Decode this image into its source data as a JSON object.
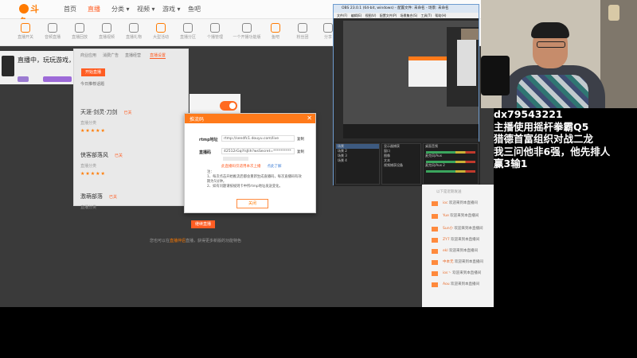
{
  "browser": {
    "logo": "斗鱼",
    "nav": [
      "首页",
      "直播",
      "分类 ▾",
      "视频 ▾",
      "游戏 ▾",
      "鱼吧"
    ],
    "nav_active": 1,
    "icon_row": [
      "直播开关",
      "音频直播",
      "直播回放",
      "直播视频",
      "直播礼物",
      "大型活动",
      "直播分区",
      "个播管理",
      "一个开播功能版",
      "鱼吧",
      "粉丝团",
      "分享"
    ]
  },
  "streamer": {
    "title": "直播中，玩玩游戏，对"
  },
  "panel": {
    "tabs": [
      "商业应用",
      "消费广告",
      "直播经营",
      "直播设置"
    ],
    "active_tab": 3,
    "start_button": "开始直播",
    "today_label": "今日推荐话题",
    "rows": [
      {
        "title": "天涯·剑灵·刀剑",
        "badge": "已关",
        "sub": "直播分类",
        "stars": "★★★★★"
      },
      {
        "title": "侠客部落风",
        "badge": "已关",
        "sub": "直播分类",
        "stars": "★★★★★"
      },
      {
        "title": "激萌部落",
        "badge": "已关",
        "sub": "直播分类",
        "stars": "★★★★★"
      }
    ]
  },
  "bottom": {
    "button": "继续直播",
    "note_before": "您也可以在",
    "note_highlight": "直播伴侣",
    "note_after": "直播，获得更多新版的功能特色"
  },
  "modal": {
    "title": "推流码",
    "close": "✕",
    "rtmp_label": "rtmp地址",
    "rtmp_value": "rtmp://sendfc1.douyu.com/live",
    "rtmp_copy": "复制",
    "key_label": "直播码",
    "key_value": "42512rGqiYsJlih?wsSecret=**********",
    "key_copy": "复制",
    "warn": "此直播码仅适用本次上播",
    "warn_link": "点此了解",
    "notes": [
      "注：",
      "1、每次点击开始推流后都会重新生成直播码，每次直播码有效期为5分钟。",
      "2、如有问题请按规则卡中所rtmp地址发送变化。"
    ],
    "ok": "关闭"
  },
  "obs": {
    "title": "OBS 23.0.1 (64-bit, windows) - 配置文件: 未命名 - 场景: 未命名",
    "menu": "文件(F) 编辑(E) 视图(V) 配置文件(P) 场景集合(S) 工具(T) 帮助(H)",
    "scenes": [
      "场景",
      "场景 2",
      "场景 3",
      "场景 4"
    ],
    "sources": [
      "显示器捕获",
      "窗口",
      "图像",
      "文本",
      "视频捕获设备"
    ],
    "mixer": [
      "桌面音频",
      "麦克风/Aux",
      "麦克风/Aux 2"
    ]
  },
  "right_panel": {
    "label": "以下是近期发送",
    "rows": [
      {
        "user": "ioc",
        "text": "欢迎来到本直播间"
      },
      {
        "user": "Yue",
        "text": "欢迎来到本直播间"
      },
      {
        "user": "Sun小",
        "text": "欢迎来到本直播间"
      },
      {
        "user": "ZY7",
        "text": "欢迎来到本直播间"
      },
      {
        "user": "ekl",
        "text": "欢迎来到本直播间"
      },
      {
        "user": "中本无",
        "text": "欢迎来到本直播间"
      },
      {
        "user": "ios丶",
        "text": "欢迎来到本直播间"
      },
      {
        "user": "Aou",
        "text": "欢迎来到本直播间"
      }
    ]
  },
  "overlay": {
    "lines": [
      "dx79543221",
      "主播使用摇杆拳霸Q5",
      "猎德首富组织对战二龙",
      "我三问他非6强，他先排人",
      "赢3输1"
    ]
  },
  "colors": {
    "accent": "#ff7a1a",
    "overlay_text": "#ffffff",
    "obs_border": "#6e9cd0"
  }
}
